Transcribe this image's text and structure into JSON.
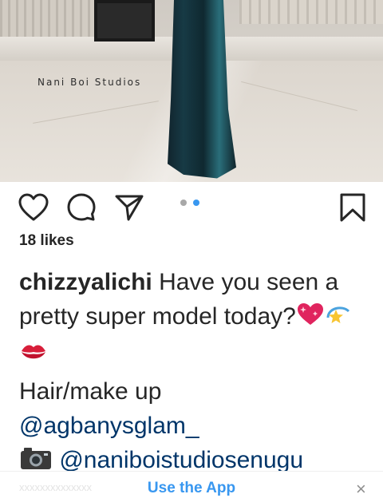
{
  "post": {
    "watermark": "Nani Boi Studios",
    "likes": "18 likes",
    "carousel": {
      "count": 2,
      "active_index": 1
    },
    "caption": {
      "username": "chizzyalichi",
      "text_line1": "Have you seen a pretty super model today?",
      "hair_label": "Hair/make up",
      "mention_makeup": "@agbanysglam_",
      "mention_studio": "@naniboistudiosenugu"
    }
  },
  "actions": {
    "like": "heart-icon",
    "comment": "comment-icon",
    "share": "share-icon",
    "save": "bookmark-icon"
  },
  "banner": {
    "ghost_text": "xxxxxxxxxxxxxx",
    "cta": "Use the App",
    "close": "×"
  },
  "colors": {
    "text": "#262626",
    "mention": "#003569",
    "cta": "#3897f0",
    "dot_active": "#3897f0",
    "dot_inactive": "#a8a8a8"
  }
}
